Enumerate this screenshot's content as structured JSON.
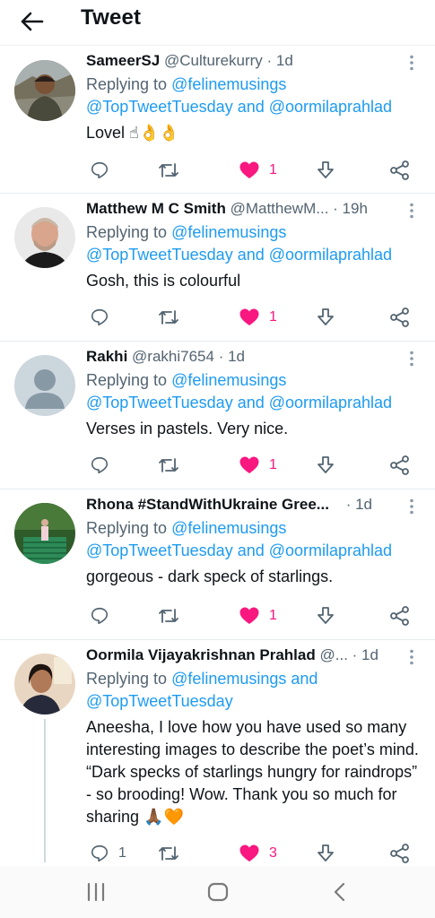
{
  "header": {
    "title": "Tweet"
  },
  "tweets": [
    {
      "name": "SameerSJ",
      "handle": "@Culturekurry",
      "time": "· 1d",
      "reply_prefix": "Replying to",
      "reply_to_1": "@felinemusings",
      "reply_to_2": "@TopTweetTuesday and @oormilaprahlad",
      "text": "Lovel ☝👌👌",
      "reply_count": "",
      "retweet_count": "",
      "like_count": "1"
    },
    {
      "name": "Matthew M C Smith",
      "handle": "@MatthewM...",
      "time": "· 19h",
      "reply_prefix": "Replying to",
      "reply_to_1": "@felinemusings",
      "reply_to_2": "@TopTweetTuesday and @oormilaprahlad",
      "text": "Gosh, this is colourful",
      "reply_count": "",
      "retweet_count": "",
      "like_count": "1"
    },
    {
      "name": "Rakhi",
      "handle": "@rakhi7654",
      "time": "· 1d",
      "reply_prefix": "Replying to",
      "reply_to_1": "@felinemusings",
      "reply_to_2": "@TopTweetTuesday and @oormilaprahlad",
      "text": "Verses in pastels. Very nice.",
      "reply_count": "",
      "retweet_count": "",
      "like_count": "1"
    },
    {
      "name": "Rhona #StandWithUkraine Gree...",
      "handle": "",
      "time": "· 1d",
      "reply_prefix": "Replying to",
      "reply_to_1": "@felinemusings",
      "reply_to_2": "@TopTweetTuesday and @oormilaprahlad",
      "text": "gorgeous - dark speck of starlings.",
      "reply_count": "",
      "retweet_count": "",
      "like_count": "1"
    },
    {
      "name": "Oormila Vijayakrishnan Prahlad",
      "handle": "@...",
      "time": "· 1d",
      "reply_prefix": "Replying to",
      "reply_to_1": "@felinemusings and",
      "reply_to_2": "@TopTweetTuesday",
      "text": "Aneesha, I love how you have used so many interesting images to describe the poet’s mind. “Dark specks of starlings hungry for raindrops” - so brooding! Wow. Thank you so much for sharing 🙏🏾🧡",
      "reply_count": "1",
      "retweet_count": "",
      "like_count": "3"
    }
  ],
  "colors": {
    "link": "#1d9bf0",
    "like": "#f91880",
    "muted": "#536471"
  },
  "icons": [
    "back-arrow-icon",
    "more-vertical-icon",
    "reply-icon",
    "retweet-icon",
    "heart-filled-icon",
    "bookmark-download-icon",
    "share-icon",
    "recent-apps-icon",
    "home-icon",
    "back-nav-icon"
  ]
}
